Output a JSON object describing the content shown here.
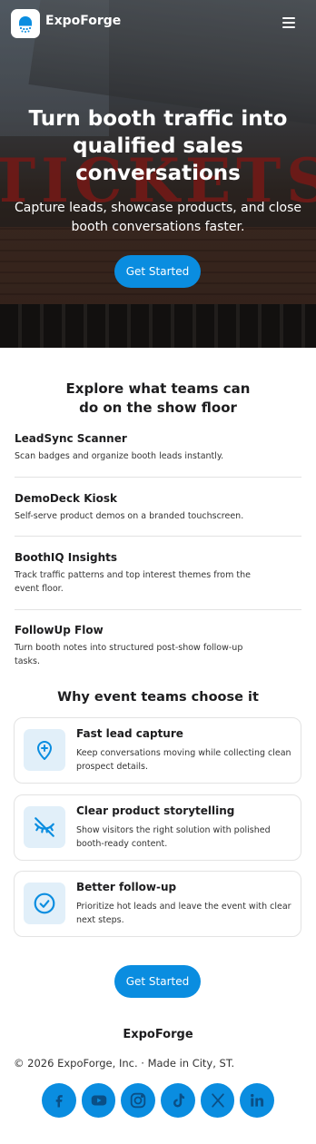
{
  "brand": {
    "name": "ExpoForge"
  },
  "hero": {
    "backdrop_text": "TICKETS",
    "title": "Turn booth traffic into qualified sales conversations",
    "subtitle": "Capture leads, showcase products, and close booth conversations faster.",
    "cta_label": "Get Started"
  },
  "explore": {
    "title": "Explore what teams can do on the show floor",
    "features": [
      {
        "title": "LeadSync Scanner",
        "desc": "Scan badges and organize booth leads instantly."
      },
      {
        "title": "DemoDeck Kiosk",
        "desc": "Self-serve product demos on a branded touchscreen."
      },
      {
        "title": "BoothIQ Insights",
        "desc": "Track traffic patterns and top interest themes from the event floor."
      },
      {
        "title": "FollowUp Flow",
        "desc": "Turn booth notes into structured post-show follow-up tasks."
      }
    ]
  },
  "why": {
    "title": "Why event teams choose it",
    "cards": [
      {
        "title": "Fast lead capture",
        "desc": "Keep conversations moving while collecting clean prospect details.",
        "icon": "location-plus-icon"
      },
      {
        "title": "Clear product storytelling",
        "desc": "Show visitors the right solution with polished booth-ready content.",
        "icon": "eye-off-icon"
      },
      {
        "title": "Better follow-up",
        "desc": "Prioritize hot leads and leave the event with clear next steps.",
        "icon": "check-circle-icon"
      }
    ]
  },
  "bottom_cta": {
    "label": "Get Started"
  },
  "footer": {
    "brand": "ExpoForge",
    "copyright": "© 2026 ExpoForge, Inc. · Made in City, ST.",
    "socials": [
      "facebook-icon",
      "youtube-icon",
      "instagram-icon",
      "tiktok-icon",
      "x-icon",
      "linkedin-icon"
    ]
  },
  "colors": {
    "accent": "#0a8de0",
    "icon_bg": "#e1eff9",
    "text": "#1d1d1f"
  }
}
